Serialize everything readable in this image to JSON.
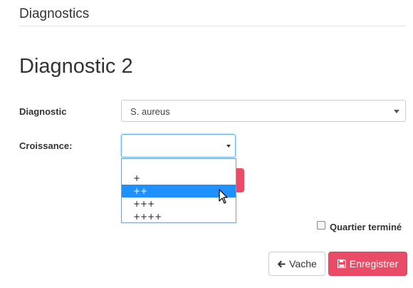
{
  "header": {
    "section_title": "Diagnostics"
  },
  "page": {
    "title": "Diagnostic 2"
  },
  "form": {
    "diagnostic": {
      "label": "Diagnostic",
      "value": "S. aureus"
    },
    "croissance": {
      "label": "Croissance:",
      "value": "",
      "options": [
        "",
        "+",
        "++",
        "+++",
        "++++"
      ],
      "highlighted_option": "++"
    },
    "quartier_termine": {
      "label": "Quartier terminé",
      "checked": false
    }
  },
  "actions": {
    "back_label": "Vache",
    "save_label": "Enregistrer"
  },
  "colors": {
    "primary_red": "#ea4b67",
    "focus_blue": "#66afe9",
    "highlight_blue": "#1e90ff"
  },
  "icons": {
    "back": "arrow-left-icon",
    "save": "floppy-disk-icon",
    "select_caret": "caret-down-icon"
  }
}
